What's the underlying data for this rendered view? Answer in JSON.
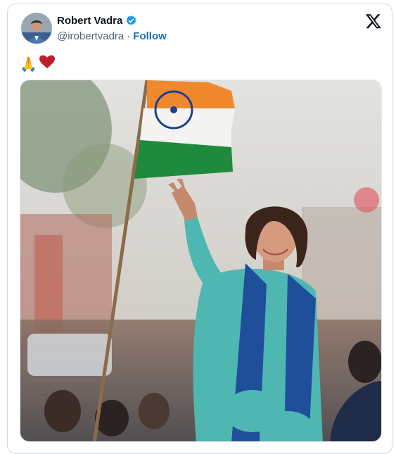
{
  "author": {
    "name": "Robert Vadra",
    "handle": "@irobertvadra",
    "follow_label": "Follow",
    "verified": true,
    "verified_color": "#1d9bf0"
  },
  "tweet": {
    "text_emoji": [
      "🙏",
      "♥"
    ],
    "emoji_icons": [
      "folded-hands-icon",
      "red-heart-icon"
    ]
  },
  "media": {
    "kind": "photo",
    "description_icon": "photo-of-woman-waving-with-flag"
  },
  "brand": {
    "logo_icon": "x-logo-icon",
    "accent": "#1d70b8",
    "text_primary": "#0f1419",
    "text_secondary": "#536471"
  }
}
